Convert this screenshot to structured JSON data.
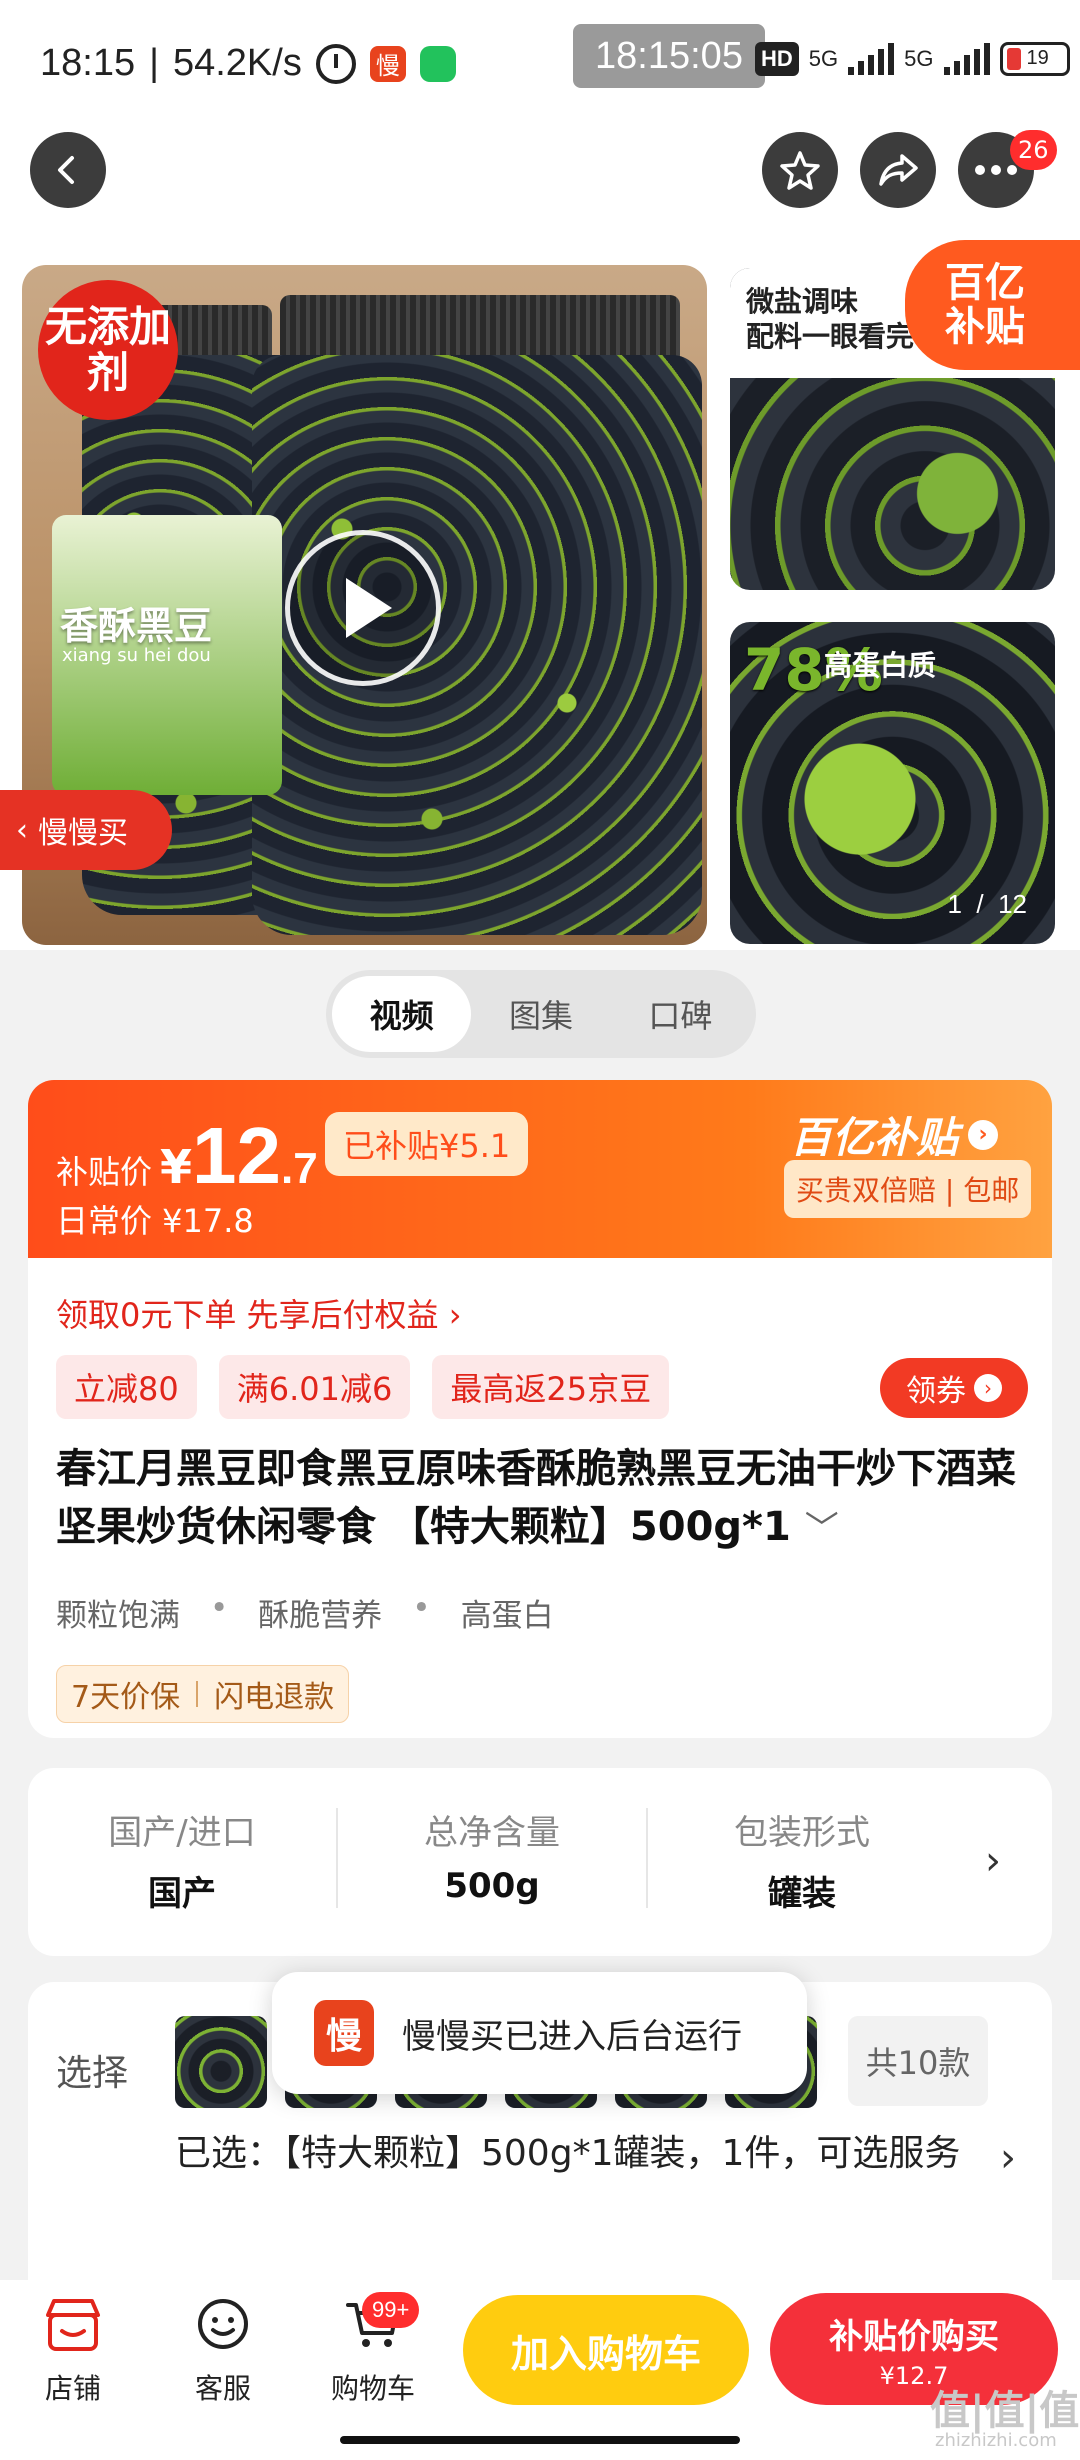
{
  "status_bar": {
    "time": "18:15",
    "speed": "54.2K/s",
    "app_icon_1": "慢",
    "clock_overlay": "18:15:05",
    "hd": "HD",
    "net1": "5G",
    "net2": "5G",
    "battery": "19",
    "icons": [
      "alarm-icon",
      "slowbuy-app-icon",
      "green-app-icon",
      "signal-icon",
      "battery-icon"
    ]
  },
  "nav": {
    "back_icon": "back-arrow-icon",
    "favorite_icon": "star-icon",
    "share_icon": "share-icon",
    "more_icon": "more-dots-icon",
    "more_badge": "26"
  },
  "gallery": {
    "no_additive_badge": "无添加剂",
    "label_title": "香酥黑豆",
    "label_pinyin": "xiang su hei dou",
    "brand": "春江月",
    "slow_buy_tab": "慢慢买",
    "thumb_a_title_line1": "微盐调味",
    "thumb_a_title_line2": "配料一眼看完",
    "yi_badge_line1": "百亿",
    "yi_badge_line2": "补贴",
    "thumb_b_pct": "78%",
    "thumb_b_text": "高蛋白质",
    "image_index": "1",
    "image_total": "12"
  },
  "tabs": [
    "视频",
    "图集",
    "口碑"
  ],
  "price": {
    "label": "补贴价",
    "currency": "¥",
    "integer": "12",
    "decimal": ".7",
    "saved": "已补贴¥5.1",
    "daily": "日常价 ¥17.8",
    "yi_title": "百亿补贴",
    "yi_sub": "买贵双倍赔 | 包邮"
  },
  "info": {
    "bnpl": "领取0元下单 先享后付权益 ›",
    "coupons": [
      "立减80",
      "满6.01减6",
      "最高返25京豆"
    ],
    "get_coupon": "领券",
    "title": "春江月黑豆即食黑豆原味香酥脆熟黑豆无油干炒下酒菜坚果炒货休闲零食 【特大颗粒】500g*1",
    "tags": [
      "颗粒饱满",
      "酥脆营养",
      "高蛋白"
    ],
    "service": [
      "7天价保",
      "闪电退款"
    ]
  },
  "specs": [
    {
      "label": "国产/进口",
      "value": "国产"
    },
    {
      "label": "总净含量",
      "value": "500g"
    },
    {
      "label": "包装形式",
      "value": "罐装"
    }
  ],
  "select": {
    "label": "选择",
    "count": "共10款",
    "selected": "已选：【特大颗粒】500g*1罐装，1件，可选服务"
  },
  "toast": {
    "icon_text": "慢",
    "text": "慢慢买已进入后台运行"
  },
  "bottom": {
    "shop": "店铺",
    "service": "客服",
    "cart": "购物车",
    "cart_badge": "99+",
    "add_cart": "加入购物车",
    "buy": "补贴价购买",
    "buy_price": "¥12.7"
  },
  "watermark": {
    "main": "值|值|值",
    "sub": "zhizhizhi.com"
  },
  "colors": {
    "accent": "#ff4d1a",
    "red": "#e1251b",
    "yellow_btn": "#ffcc0f",
    "buy_btn": "#f4303a"
  }
}
